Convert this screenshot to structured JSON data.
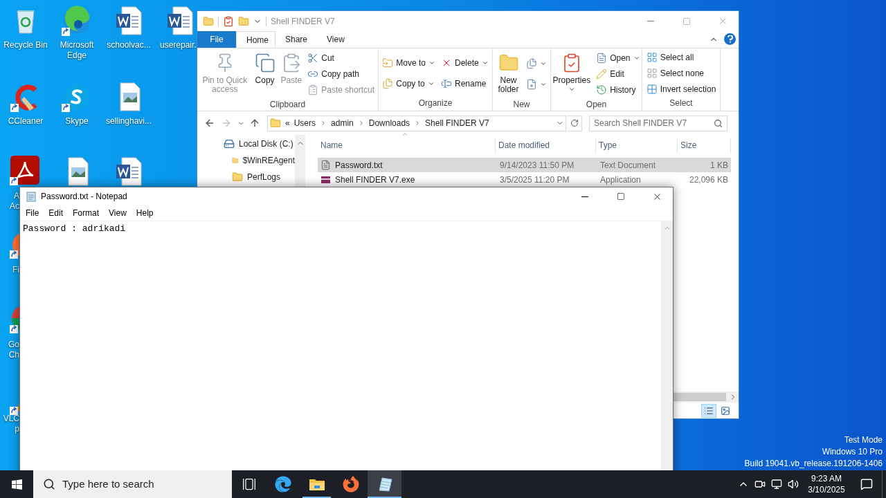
{
  "desktop": {
    "icons": [
      {
        "label": "Recycle Bin",
        "kind": "recycle",
        "shortcut": false
      },
      {
        "label": "Microsoft Edge",
        "kind": "edge",
        "shortcut": true
      },
      {
        "label": "schoolvac...",
        "kind": "word",
        "shortcut": false
      },
      {
        "label": "userepair.",
        "kind": "word",
        "shortcut": false
      },
      {
        "label": "CCleaner",
        "kind": "ccleaner",
        "shortcut": true
      },
      {
        "label": "Skype",
        "kind": "skype",
        "shortcut": true
      },
      {
        "label": "sellinghavi...",
        "kind": "image",
        "shortcut": false
      }
    ],
    "partial_icons": [
      {
        "kind": "image"
      },
      {
        "kind": "word"
      }
    ],
    "covered_icons": [
      {
        "kind": "acrobat",
        "shortcut": true,
        "lines": [
          "A",
          "Ac"
        ]
      },
      {
        "kind": "firefox",
        "shortcut": true,
        "lines": [
          "Fi"
        ]
      },
      {
        "kind": "chrome",
        "shortcut": true,
        "lines": [
          "Go",
          "Ch"
        ]
      },
      {
        "kind": "vlc",
        "shortcut": true,
        "lines": [
          "VLC",
          "p"
        ]
      }
    ],
    "watermark": [
      "Test Mode",
      "Windows 10 Pro",
      "Build 19041.vb_release.191206-1406"
    ]
  },
  "explorer": {
    "title": "Shell FINDER V7",
    "file_tab": "File",
    "tabs": [
      {
        "label": "Home",
        "selected": true
      },
      {
        "label": "Share",
        "selected": false
      },
      {
        "label": "View",
        "selected": false
      }
    ],
    "ribbon": [
      {
        "name": "Clipboard",
        "columns": [
          [
            {
              "label": "Pin to Quick access",
              "disabled": true,
              "dropdown": false
            }
          ],
          [
            {
              "label": "Copy",
              "disabled": false,
              "dropdown": false
            }
          ],
          [
            {
              "label": "Paste",
              "disabled": true,
              "dropdown": false
            }
          ],
          [
            {
              "label": "Cut",
              "disabled": false,
              "dropdown": false
            },
            {
              "label": "Copy path",
              "disabled": false,
              "dropdown": false
            },
            {
              "label": "Paste shortcut",
              "disabled": true,
              "dropdown": false
            }
          ]
        ]
      },
      {
        "name": "Organize",
        "columns": [
          [
            {
              "label": "Move to",
              "disabled": false,
              "dropdown": true
            },
            {
              "label": "Copy to",
              "disabled": false,
              "dropdown": true
            }
          ],
          [
            {
              "label": "Delete",
              "disabled": false,
              "dropdown": true
            },
            {
              "label": "Rename",
              "disabled": false,
              "dropdown": false
            }
          ]
        ]
      },
      {
        "name": "New",
        "columns": [
          [
            {
              "label": "New folder",
              "disabled": false,
              "dropdown": false
            }
          ],
          [
            {
              "disabled": false,
              "dropdown": true
            },
            {
              "disabled": false,
              "dropdown": true
            }
          ]
        ]
      },
      {
        "name": "Open",
        "columns": [
          [
            {
              "label": "Properties",
              "disabled": false,
              "dropdown": true
            }
          ],
          [
            {
              "label": "Open",
              "disabled": false,
              "dropdown": true
            },
            {
              "label": "Edit",
              "disabled": false,
              "dropdown": false
            },
            {
              "label": "History",
              "disabled": false,
              "dropdown": false
            }
          ]
        ]
      },
      {
        "name": "Select",
        "columns": [
          [
            {
              "label": "Select all",
              "disabled": false,
              "dropdown": false
            },
            {
              "label": "Select none",
              "disabled": false,
              "dropdown": false
            },
            {
              "label": "Invert selection",
              "disabled": false,
              "dropdown": false
            }
          ]
        ]
      }
    ],
    "address": {
      "overflow": "«",
      "crumbs": [
        "Users",
        "admin",
        "Downloads",
        "Shell FINDER V7"
      ]
    },
    "search": {
      "placeholder": "Search Shell FINDER V7"
    },
    "nav": [
      {
        "label": "Local Disk (C:)",
        "kind": "drive"
      },
      {
        "label": "$WinREAgent",
        "kind": "folder"
      },
      {
        "label": "PerfLogs",
        "kind": "folder"
      }
    ],
    "columns": [
      "Name",
      "Date modified",
      "Type",
      "Size"
    ],
    "rows": [
      {
        "cells": [
          "Password.txt",
          "9/14/2023 11:50 PM",
          "Text Document",
          "1 KB"
        ],
        "kind": "text",
        "selected": true
      },
      {
        "cells": [
          "Shell FINDER V7.exe",
          "3/5/2025 11:20 PM",
          "Application",
          "22,096 KB"
        ],
        "kind": "app",
        "selected": false
      }
    ],
    "views": [
      {
        "kind": "details",
        "selected": true
      },
      {
        "kind": "large",
        "selected": false
      }
    ]
  },
  "notepad": {
    "title": "Password.txt - Notepad",
    "menu": [
      "File",
      "Edit",
      "Format",
      "View",
      "Help"
    ],
    "text": "Password : adrikadi"
  },
  "taskbar": {
    "search": {
      "placeholder": "Type here to search"
    },
    "apps": [
      {
        "kind": "taskview",
        "running": false,
        "active": false
      },
      {
        "kind": "edge",
        "running": false,
        "active": false
      },
      {
        "kind": "explorer",
        "running": true,
        "active": false
      },
      {
        "kind": "firefox",
        "running": false,
        "active": false
      },
      {
        "kind": "notepad",
        "running": true,
        "active": true
      }
    ],
    "time": "9:23 AM",
    "date": "3/10/2025"
  }
}
